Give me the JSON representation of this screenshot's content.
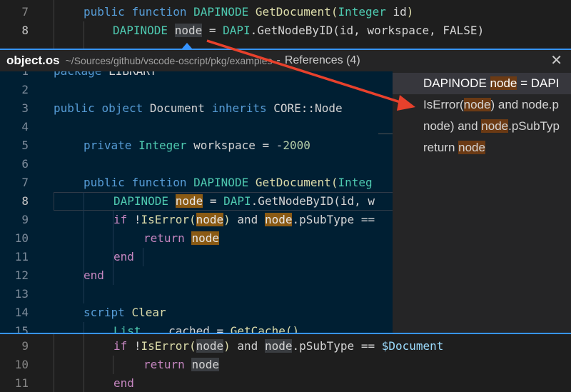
{
  "top_editor": {
    "lines": [
      {
        "num": "7",
        "tokens": [
          [
            "kw",
            "public"
          ],
          [
            "plain",
            " "
          ],
          [
            "kw",
            "function"
          ],
          [
            "plain",
            " "
          ],
          [
            "ty",
            "DAPINODE"
          ],
          [
            "plain",
            " "
          ],
          [
            "fn",
            "GetDocument"
          ],
          [
            "fn",
            "("
          ],
          [
            "ty",
            "Integer"
          ],
          [
            "plain",
            " id"
          ],
          [
            "fn",
            ")"
          ]
        ]
      },
      {
        "num": "8",
        "tokens": [
          [
            "ty",
            "DAPINODE"
          ],
          [
            "plain",
            " "
          ],
          [
            "hl2",
            "node"
          ],
          [
            "plain",
            " = "
          ],
          [
            "ty",
            "DAPI"
          ],
          [
            "plain",
            "."
          ],
          [
            "plain",
            "GetNodeByID(id, workspace, FALSE)"
          ]
        ]
      }
    ]
  },
  "peek": {
    "file": "object.os",
    "path": "~/Sources/github/vscode-oscript/pkg/examples",
    "separator": "-",
    "title": "References (4)",
    "close": "✕",
    "lines": [
      {
        "num": "1",
        "code": [
          [
            "kw",
            "package"
          ],
          [
            "plain",
            " LIBRARY"
          ]
        ]
      },
      {
        "num": "2",
        "code": []
      },
      {
        "num": "3",
        "code": [
          [
            "kw",
            "public"
          ],
          [
            "plain",
            " "
          ],
          [
            "kw",
            "object"
          ],
          [
            "plain",
            " Document "
          ],
          [
            "kw",
            "inherits"
          ],
          [
            "plain",
            " CORE::Node"
          ]
        ]
      },
      {
        "num": "4",
        "code": []
      },
      {
        "num": "5",
        "code": [
          [
            "kw",
            "private"
          ],
          [
            "plain",
            " "
          ],
          [
            "ty",
            "Integer"
          ],
          [
            "plain",
            " workspace = -"
          ],
          [
            "num",
            "2000"
          ]
        ]
      },
      {
        "num": "6",
        "code": []
      },
      {
        "num": "7",
        "code": [
          [
            "kw",
            "public"
          ],
          [
            "plain",
            " "
          ],
          [
            "kw",
            "function"
          ],
          [
            "plain",
            " "
          ],
          [
            "ty",
            "DAPINODE"
          ],
          [
            "plain",
            " "
          ],
          [
            "fn",
            "GetDocument"
          ],
          [
            "fn",
            "("
          ],
          [
            "ty",
            "Integ"
          ]
        ]
      },
      {
        "num": "8",
        "code": [
          [
            "ty",
            "DAPINODE"
          ],
          [
            "plain",
            " "
          ],
          [
            "hl",
            "node"
          ],
          [
            "plain",
            " = "
          ],
          [
            "ty",
            "DAPI"
          ],
          [
            "plain",
            ".GetNodeByID(id, w"
          ]
        ]
      },
      {
        "num": "9",
        "code": [
          [
            "ctl",
            "if"
          ],
          [
            "plain",
            " !"
          ],
          [
            "fn",
            "IsError"
          ],
          [
            "fn",
            "("
          ],
          [
            "hl",
            "node"
          ],
          [
            "fn",
            ")"
          ],
          [
            "plain",
            " and "
          ],
          [
            "hl",
            "node"
          ],
          [
            "plain",
            ".pSubType =="
          ]
        ]
      },
      {
        "num": "10",
        "code": [
          [
            "ctl",
            "return"
          ],
          [
            "plain",
            " "
          ],
          [
            "hl",
            "node"
          ]
        ]
      },
      {
        "num": "11",
        "code": [
          [
            "ctl",
            "end"
          ]
        ]
      },
      {
        "num": "12",
        "code": [
          [
            "ctl",
            "end"
          ]
        ]
      },
      {
        "num": "13",
        "code": []
      },
      {
        "num": "14",
        "code": [
          [
            "kw",
            "script"
          ],
          [
            "plain",
            " "
          ],
          [
            "fn",
            "Clear"
          ]
        ]
      },
      {
        "num": "15",
        "code": [
          [
            "ty",
            "List"
          ],
          [
            "plain",
            "    cached = "
          ],
          [
            "fn",
            "GetCache"
          ],
          [
            "fn",
            "()"
          ]
        ]
      }
    ]
  },
  "references": [
    {
      "pre": "DAPINODE ",
      "hit": "node",
      "post": " = DAPI",
      "selected": true
    },
    {
      "pre": "IsError(",
      "hit": "node",
      "post": ") and node.p",
      "selected": false
    },
    {
      "pre": "node) and ",
      "hit": "node",
      "post": ".pSubTyp",
      "selected": false
    },
    {
      "pre": "return ",
      "hit": "node",
      "post": "",
      "selected": false
    }
  ],
  "bottom_editor": {
    "lines": [
      {
        "num": "9",
        "tokens": [
          [
            "ctl",
            "if"
          ],
          [
            "plain",
            " !"
          ],
          [
            "fn",
            "IsError"
          ],
          [
            "fn",
            "("
          ],
          [
            "hl2",
            "node"
          ],
          [
            "fn",
            ")"
          ],
          [
            "plain",
            " and "
          ],
          [
            "hl2",
            "node"
          ],
          [
            "plain",
            ".pSubType == "
          ],
          [
            "var",
            "$Document"
          ]
        ]
      },
      {
        "num": "10",
        "tokens": [
          [
            "ctl",
            "return"
          ],
          [
            "plain",
            " "
          ],
          [
            "hl2",
            "node"
          ]
        ]
      },
      {
        "num": "11",
        "tokens": [
          [
            "ctl",
            "end"
          ]
        ]
      }
    ]
  },
  "colors": {
    "accent": "#3794ff",
    "annotation_arrow": "#e8412c",
    "highlight": "#8a5a14"
  }
}
